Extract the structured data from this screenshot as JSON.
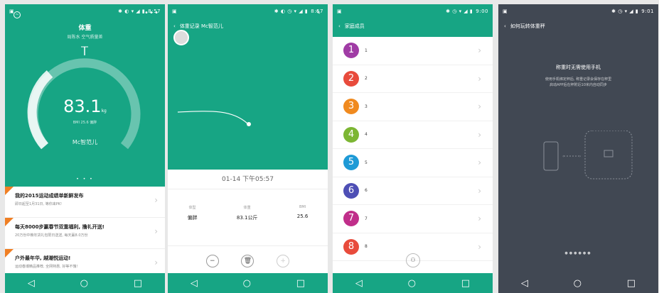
{
  "status": {
    "time1": "8:57",
    "time2": "8:57",
    "time3": "9:00",
    "time4": "9:01"
  },
  "nav": {
    "back": "◁",
    "home": "○",
    "recent": "□"
  },
  "p1": {
    "title": "体重",
    "subtitle": "局陈水 空气质量差",
    "weight": "83.1",
    "unit": "kg",
    "bmi": "BMI 25.6 偏胖",
    "user": "Mc智范儿",
    "news": [
      {
        "title": "我的2015运动成绩单新鲜发布",
        "desc": "即日起至1月31日, 等你来PK!"
      },
      {
        "title": "每天8000步赢春节双重福利, 撸礼开送!",
        "desc": "20万份中粮年货礼包限日送送, 每天赢8.0万份"
      },
      {
        "title": "户外最年华, 越潮悦运动!",
        "desc": "运动春潮精品推荐, 全网特惠, 好等不愧!"
      }
    ]
  },
  "p2": {
    "title": "体重记录  Mc智范儿",
    "date": "01-14 下午05:57",
    "stats": [
      {
        "k": "体型",
        "v": "偏胖"
      },
      {
        "k": "体重",
        "v": "83.1公斤"
      },
      {
        "k": "BMI",
        "v": "25.6"
      }
    ]
  },
  "p3": {
    "title": "家庭成员",
    "members": [
      {
        "n": "1",
        "label": "1",
        "color": "#a03ca5"
      },
      {
        "n": "2",
        "label": "2",
        "color": "#e84b3c"
      },
      {
        "n": "3",
        "label": "3",
        "color": "#f08a1f"
      },
      {
        "n": "4",
        "label": "4",
        "color": "#7cb633"
      },
      {
        "n": "5",
        "label": "5",
        "color": "#1e9ad6"
      },
      {
        "n": "6",
        "label": "6",
        "color": "#4e4fb5"
      },
      {
        "n": "7",
        "label": "7",
        "color": "#c02e8a"
      },
      {
        "n": "8",
        "label": "8",
        "color": "#e84b3c"
      }
    ]
  },
  "p4": {
    "title": "如何玩转体重秤",
    "heading": "称重时无需使用手机",
    "desc1": "使用手机绑定秤后, 称重记录会保存在秤里",
    "desc2": "启动APP后在秤附近10米内自动同步"
  }
}
